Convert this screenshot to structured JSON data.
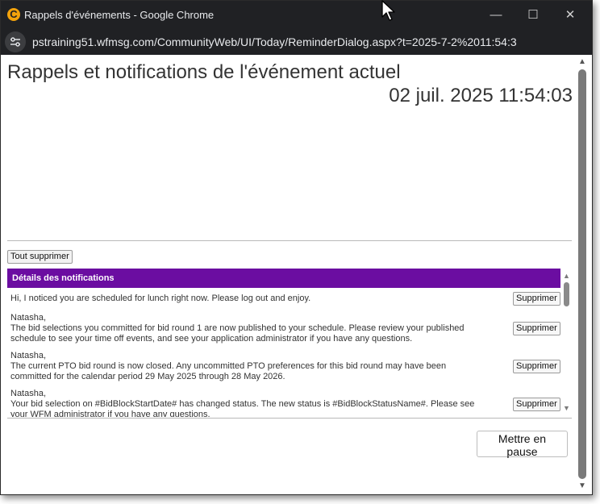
{
  "window": {
    "title": "Rappels d'événements - Google Chrome",
    "app_icon_glyph": "C",
    "controls": {
      "minimize": "—",
      "maximize": "☐",
      "close": "✕"
    }
  },
  "address_bar": {
    "url": "pstraining51.wfmsg.com/CommunityWeb/UI/Today/ReminderDialog.aspx?t=2025-7-2%2011:54:3"
  },
  "page": {
    "title": "Rappels et notifications de l'événement actuel",
    "datetime": "02 juil. 2025 11:54:03",
    "delete_all_label": "Tout supprimer",
    "notifications_header": "Détails des notifications",
    "delete_label": "Supprimer",
    "pause_label": "Mettre en pause"
  },
  "notifications": [
    {
      "text": "Hi, I noticed you are scheduled for lunch right now. Please log out and enjoy."
    },
    {
      "text": "Natasha,\nThe bid selections you committed for bid round 1 are now published to your schedule. Please review your published schedule to see your time off events, and see your application administrator if you have any questions."
    },
    {
      "text": "Natasha,\nThe current PTO bid round is now closed. Any uncommitted PTO preferences for this bid round may have been committed for the calendar period 29 May 2025 through 28 May 2026."
    },
    {
      "text": "Natasha,\nYour bid selection on #BidBlockStartDate# has changed status. The new status is #BidBlockStatusName#. Please see your WFM administrator if you have any questions."
    }
  ],
  "colors": {
    "titlebar": "#202124",
    "header_purple": "#6b0da1",
    "app_icon": "#f2a20c"
  },
  "icons": {
    "app": "app-logo-icon",
    "site_info": "tune-icon",
    "cursor": "mouse-pointer-icon"
  }
}
